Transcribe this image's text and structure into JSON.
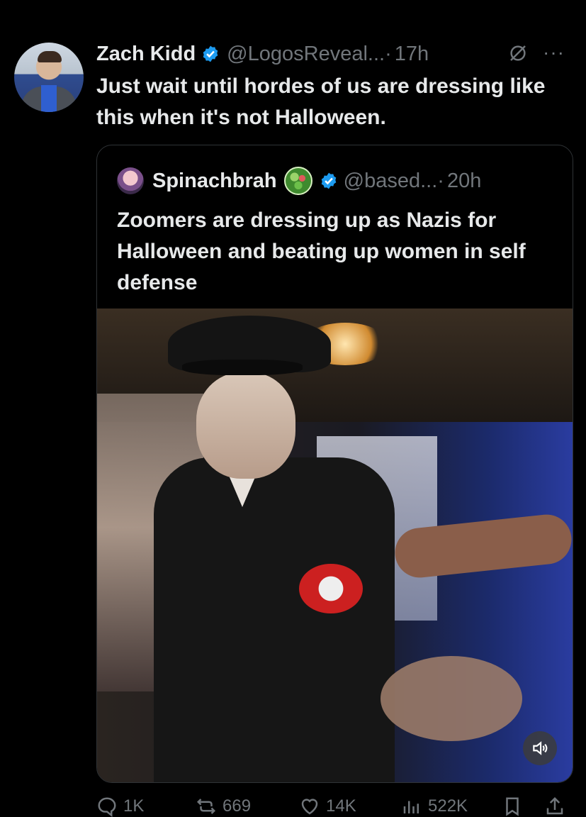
{
  "tweet": {
    "author_name": "Zach Kidd",
    "handle": "@LogosReveal...",
    "separator": "·",
    "time": "17h",
    "more_label": "···",
    "text": "Just wait until hordes of us are dressing like this when it's not Halloween."
  },
  "quoted": {
    "author_name": "Spinachbrah",
    "handle": "@based...",
    "separator": "·",
    "time": "20h",
    "text": "Zoomers are dressing up as Nazis for Halloween and beating up women in self defense"
  },
  "actions": {
    "replies": "1K",
    "reposts": "669",
    "likes": "14K",
    "views": "522K"
  },
  "colors": {
    "background": "#000000",
    "text": "#e7e9ea",
    "muted": "#71767b",
    "verified": "#1d9bf0",
    "border": "#2f3336"
  },
  "icons": [
    "verified-badge-icon",
    "grok-icon",
    "more-icon",
    "spinach-emoji-icon",
    "sound-icon",
    "reply-icon",
    "repost-icon",
    "like-icon",
    "views-icon",
    "bookmark-icon",
    "share-icon"
  ]
}
